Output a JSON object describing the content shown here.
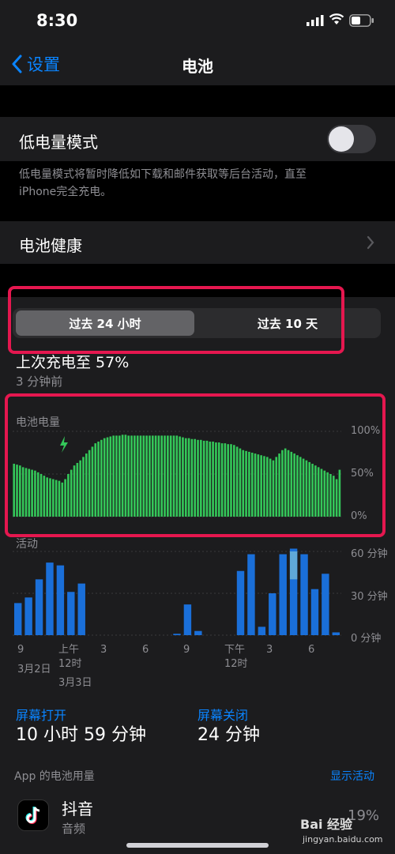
{
  "status": {
    "time": "8:30"
  },
  "nav": {
    "back_label": "设置",
    "title": "电池"
  },
  "low_power": {
    "label": "低电量模式",
    "enabled": false,
    "note_line1": "低电量模式将暂时降低如下载和邮件获取等后台活动，直至",
    "note_line2": "iPhone完全充电。"
  },
  "battery_health": {
    "label": "电池健康"
  },
  "segmented": {
    "options": [
      "过去 24 小时",
      "过去 10 天"
    ],
    "selected": 0
  },
  "last_charge": {
    "label": "上次充电至 57%",
    "time": "3 分钟前"
  },
  "battery_chart": {
    "title": "电池电量",
    "y_ticks": [
      "100%",
      "50%",
      "0%"
    ]
  },
  "activity_chart": {
    "title": "活动",
    "y_ticks": [
      "60 分钟",
      "30 分钟",
      "0 分钟"
    ]
  },
  "x_axis": {
    "ticks": [
      "9",
      "上午\n12时",
      "3",
      "6",
      "9",
      "下午\n12时",
      "3",
      "6"
    ],
    "dates": [
      "3月2日",
      "3月3日"
    ]
  },
  "chart_data": [
    {
      "type": "bar",
      "title": "电池电量",
      "ylim": [
        0,
        100
      ],
      "y_ticks": [
        "100%",
        "50%",
        "0%"
      ],
      "values": [
        62,
        61,
        60,
        58,
        57,
        56,
        55,
        54,
        52,
        50,
        48,
        46,
        45,
        44,
        43,
        42,
        40,
        44,
        50,
        55,
        60,
        63,
        66,
        70,
        74,
        78,
        82,
        86,
        88,
        90,
        92,
        93,
        94,
        95,
        95,
        95,
        96,
        96,
        95,
        95,
        95,
        95,
        95,
        95,
        95,
        95,
        95,
        95,
        95,
        95,
        95,
        95,
        95,
        95,
        95,
        94,
        93,
        92,
        92,
        91,
        91,
        90,
        90,
        89,
        89,
        88,
        88,
        87,
        87,
        86,
        86,
        85,
        85,
        84,
        82,
        80,
        78,
        77,
        76,
        75,
        74,
        73,
        72,
        71,
        70,
        68,
        66,
        70,
        74,
        78,
        80,
        78,
        76,
        74,
        72,
        70,
        68,
        66,
        64,
        62,
        60,
        58,
        56,
        54,
        52,
        50,
        48,
        44,
        55
      ],
      "colors": {
        "bar": "#34c759",
        "charging_hatch": "#2f6a3c"
      }
    },
    {
      "type": "bar",
      "title": "活动",
      "ylim": [
        0,
        60
      ],
      "y_ticks": [
        "60 分钟",
        "30 分钟",
        "0 分钟"
      ],
      "values": [
        23,
        27,
        40,
        52,
        50,
        31,
        37,
        0,
        0,
        0,
        0,
        0,
        0,
        0,
        0,
        1,
        22,
        3,
        0,
        0,
        0,
        46,
        58,
        6,
        30,
        58,
        62,
        58,
        33,
        44,
        2
      ],
      "highlight_extra": [
        {
          "index": 26,
          "value": 20
        }
      ],
      "colors": {
        "bar": "#1a6fd9",
        "highlight": "#5fa8d8"
      }
    }
  ],
  "usage": {
    "screen_on_label": "屏幕打开",
    "screen_on_value": "10 小时 59 分钟",
    "screen_off_label": "屏幕关闭",
    "screen_off_value": "24 分钟"
  },
  "app_usage": {
    "header": "App 的电池用量",
    "show_activity": "显示活动"
  },
  "apps": [
    {
      "name": "抖音",
      "category": "音频",
      "percent": "19%"
    }
  ],
  "watermark": {
    "brand": "Bai 经验",
    "url": "jingyan.baidu.com"
  },
  "accent_colors": {
    "blue": "#0a84ff",
    "highlight_border": "#e5174f"
  }
}
